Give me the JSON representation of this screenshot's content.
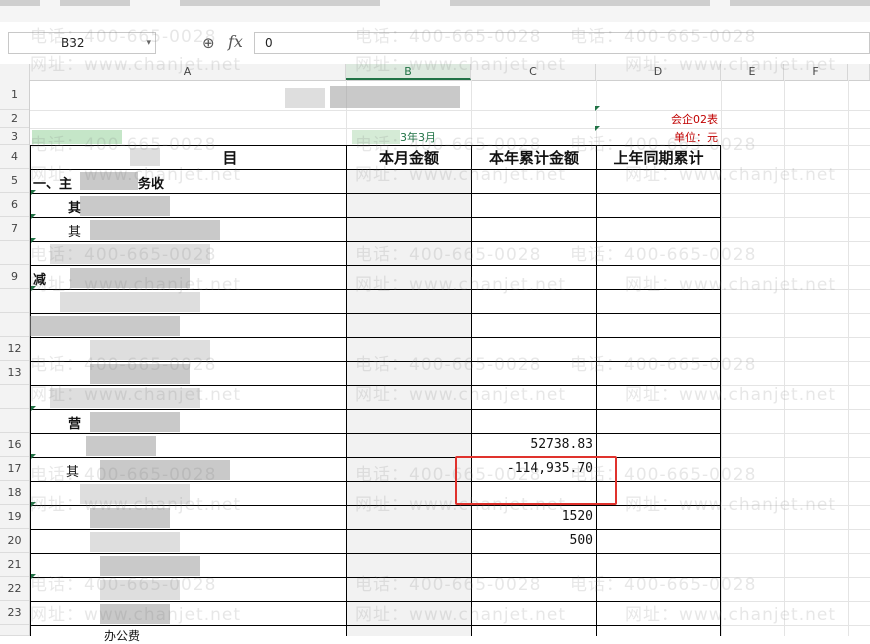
{
  "name_box": {
    "value": "B32"
  },
  "formula_bar": {
    "value": "0",
    "fx_label": "fx"
  },
  "columns": [
    "A",
    "B",
    "C",
    "D",
    "E",
    "F"
  ],
  "rows": [
    "1",
    "2",
    "3",
    "4",
    "5",
    "6",
    "7",
    "",
    "9",
    "",
    "",
    "12",
    "13",
    "",
    "",
    "16",
    "17",
    "18",
    "19",
    "20",
    "21",
    "22",
    "23",
    ""
  ],
  "report": {
    "form_code": "会企02表",
    "unit": "单位：元",
    "period_fragment": "3年3月",
    "header_item_fragment": "目",
    "header_this_month": "本月金额",
    "header_ytd": "本年累计金额",
    "header_prior_ytd": "上年同期累计",
    "row5_label": "一、主",
    "row5_label_tail": "务收",
    "row6_label": "其",
    "row7_label": "其",
    "row9_label": "减",
    "row15_label": "营",
    "row17_label": "其",
    "row23_label": "办公费"
  },
  "values": {
    "r16_ytd": "52738.83",
    "r17_ytd": "-114,935.70",
    "r19_ytd": "1520",
    "r20_ytd": "500"
  },
  "watermark": {
    "phone": "电话：400-665-0028",
    "site": "网址：www.chanjet.net"
  },
  "colors": {
    "highlight": "#e0322d",
    "red_text": "#c00000",
    "accent_green": "#217346"
  }
}
